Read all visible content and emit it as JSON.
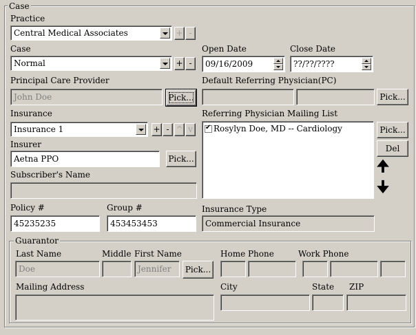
{
  "case_group": {
    "legend": "Case"
  },
  "practice": {
    "label": "Practice",
    "value": "Central Medical Associates"
  },
  "case": {
    "label": "Case",
    "value": "Normal"
  },
  "open_date": {
    "label": "Open Date",
    "value": "09/16/2009"
  },
  "close_date": {
    "label": "Close Date",
    "value": "??/??/????"
  },
  "pcp": {
    "label": "Principal Care Provider",
    "value": "John Doe",
    "pick_label": "Pick..."
  },
  "default_ref": {
    "label": "Default Referring Physician(PC)",
    "value1": "",
    "value2": "",
    "pick_label": "Pick..."
  },
  "insurance": {
    "label": "Insurance",
    "value": "Insurance 1"
  },
  "insurer": {
    "label": "Insurer",
    "value": "Aetna PPO",
    "pick_label": "Pick..."
  },
  "subscriber": {
    "label": "Subscriber's Name",
    "value": ""
  },
  "ref_mailing": {
    "label": "Referring Physician Mailing List",
    "items": [
      "Rosylyn Doe, MD -- Cardiology"
    ],
    "pick_label": "Pick...",
    "del_label": "Del"
  },
  "policy": {
    "label": "Policy #",
    "value": "45235235"
  },
  "group": {
    "label": "Group #",
    "value": "453453453"
  },
  "insurance_type": {
    "label": "Insurance Type",
    "value": "Commercial Insurance"
  },
  "small_buttons": {
    "plus": "+",
    "minus": "-",
    "up": "^",
    "down": "v"
  },
  "guarantor": {
    "legend": "Guarantor",
    "last_name": {
      "label": "Last Name",
      "value": "Doe"
    },
    "middle": {
      "label": "Middle",
      "value": ""
    },
    "first_name": {
      "label": "First Name",
      "value": "Jennifer"
    },
    "pick_label": "Pick...",
    "home_phone": {
      "label": "Home Phone"
    },
    "work_phone": {
      "label": "Work Phone"
    },
    "mailing_address": {
      "label": "Mailing Address",
      "value": ""
    },
    "city": {
      "label": "City",
      "value": ""
    },
    "state": {
      "label": "State",
      "value": ""
    },
    "zip": {
      "label": "ZIP",
      "value": ""
    }
  }
}
